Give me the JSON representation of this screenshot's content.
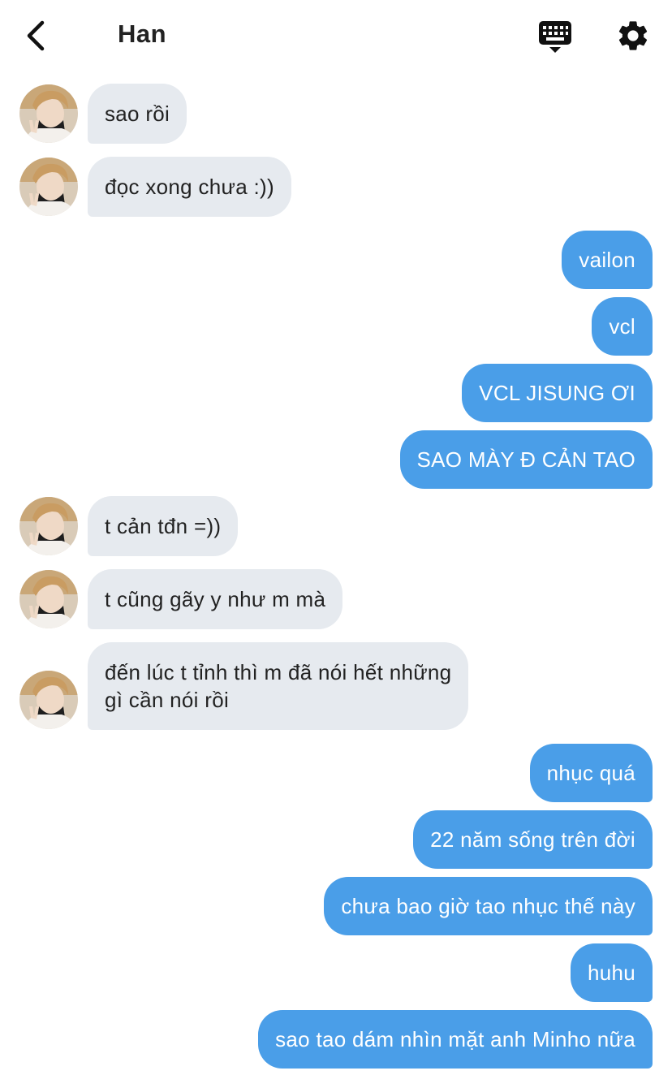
{
  "header": {
    "title": "Han"
  },
  "icons": {
    "back": "chevron-left-icon",
    "keyboard": "keyboard-icon",
    "settings": "gear-icon"
  },
  "colors": {
    "incoming_bubble": "#e6eaef",
    "outgoing_bubble": "#4a9ee8",
    "text": "#222222"
  },
  "messages": [
    {
      "sender": "Han",
      "direction": "incoming",
      "text": "sao rồi"
    },
    {
      "sender": "Han",
      "direction": "incoming",
      "text": "đọc xong chưa :))"
    },
    {
      "sender": "me",
      "direction": "outgoing",
      "text": "vailon"
    },
    {
      "sender": "me",
      "direction": "outgoing",
      "text": "vcl"
    },
    {
      "sender": "me",
      "direction": "outgoing",
      "text": "VCL JISUNG ƠI"
    },
    {
      "sender": "me",
      "direction": "outgoing",
      "text": "SAO MÀY Đ CẢN TAO"
    },
    {
      "sender": "Han",
      "direction": "incoming",
      "text": "t cản tđn =))"
    },
    {
      "sender": "Han",
      "direction": "incoming",
      "text": "t cũng gãy y như m mà"
    },
    {
      "sender": "Han",
      "direction": "incoming",
      "lines": [
        "đến lúc t tỉnh thì m đã nói hết những",
        "gì cần nói rồi"
      ]
    },
    {
      "sender": "me",
      "direction": "outgoing",
      "text": "nhục quá"
    },
    {
      "sender": "me",
      "direction": "outgoing",
      "text": "22 năm sống trên đời"
    },
    {
      "sender": "me",
      "direction": "outgoing",
      "text": "chưa bao giờ tao nhục thế này"
    },
    {
      "sender": "me",
      "direction": "outgoing",
      "text": "huhu"
    },
    {
      "sender": "me",
      "direction": "outgoing",
      "text": "sao tao dám nhìn mặt anh Minho nữa"
    }
  ]
}
